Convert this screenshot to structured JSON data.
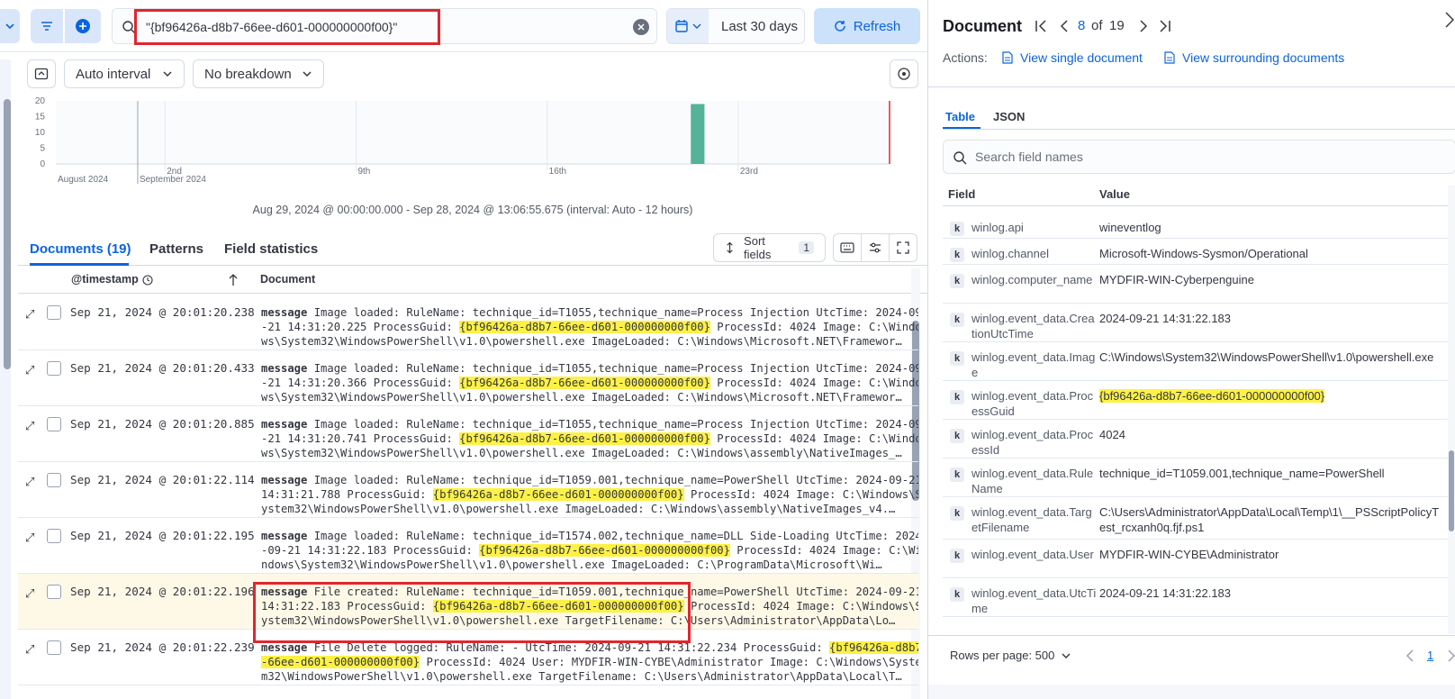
{
  "query": {
    "text": "\"{bf96426a-d8b7-66ee-d601-000000000f00}\""
  },
  "timepicker": {
    "label": "Last 30 days"
  },
  "refresh_label": "Refresh",
  "toolbar": {
    "interval_label": "Auto interval",
    "breakdown_label": "No breakdown"
  },
  "chart_data": {
    "type": "bar",
    "y_ticks": [
      "20",
      "15",
      "10",
      "5",
      "0"
    ],
    "ylim": [
      0,
      20
    ],
    "x_tick_labels": [
      "August 2024",
      "September 2024",
      "2nd",
      "9th",
      "16th",
      "23rd"
    ],
    "bars": [
      {
        "x": "2024-09-21",
        "value": 19
      }
    ],
    "caption": "Aug 29, 2024 @ 00:00:00.000 - Sep 28, 2024 @ 13:06:55.675 (interval: Auto - 12 hours)"
  },
  "tabs": {
    "documents": "Documents (19)",
    "patterns": "Patterns",
    "field_statistics": "Field statistics"
  },
  "sort": {
    "label": "Sort fields",
    "count": "1"
  },
  "table": {
    "col_timestamp": "@timestamp",
    "col_document": "Document",
    "rows": [
      {
        "ts": "Sep 21, 2024 @ 20:01:20.238",
        "key": "message",
        "pre": " Image loaded: RuleName: technique_id=T1055,technique_name=Process Injection UtcTime: 2024-09-21 14:31:20.225 ProcessGuid: ",
        "hl": "{bf96426a-d8b7-66ee-d601-000000000f00}",
        "post": " ProcessId: 4024 Image: C:\\Windows\\System32\\WindowsPowerShell\\v1.0\\powershell.exe ImageLoaded: C:\\Windows\\Microsoft.NET\\Framewor…"
      },
      {
        "ts": "Sep 21, 2024 @ 20:01:20.433",
        "key": "message",
        "pre": " Image loaded: RuleName: technique_id=T1055,technique_name=Process Injection UtcTime: 2024-09-21 14:31:20.366 ProcessGuid: ",
        "hl": "{bf96426a-d8b7-66ee-d601-000000000f00}",
        "post": " ProcessId: 4024 Image: C:\\Windows\\System32\\WindowsPowerShell\\v1.0\\powershell.exe ImageLoaded: C:\\Windows\\Microsoft.NET\\Framewor…"
      },
      {
        "ts": "Sep 21, 2024 @ 20:01:20.885",
        "key": "message",
        "pre": " Image loaded: RuleName: technique_id=T1055,technique_name=Process Injection UtcTime: 2024-09-21 14:31:20.741 ProcessGuid: ",
        "hl": "{bf96426a-d8b7-66ee-d601-000000000f00}",
        "post": " ProcessId: 4024 Image: C:\\Windows\\System32\\WindowsPowerShell\\v1.0\\powershell.exe ImageLoaded: C:\\Windows\\assembly\\NativeImages_…"
      },
      {
        "ts": "Sep 21, 2024 @ 20:01:22.114",
        "key": "message",
        "pre": " Image loaded: RuleName: technique_id=T1059.001,technique_name=PowerShell UtcTime: 2024-09-21 14:31:21.788 ProcessGuid: ",
        "hl": "{bf96426a-d8b7-66ee-d601-000000000f00}",
        "post": " ProcessId: 4024 Image: C:\\Windows\\System32\\WindowsPowerShell\\v1.0\\powershell.exe ImageLoaded: C:\\Windows\\assembly\\NativeImages_v4.…"
      },
      {
        "ts": "Sep 21, 2024 @ 20:01:22.195",
        "key": "message",
        "pre": " Image loaded: RuleName: technique_id=T1574.002,technique_name=DLL Side-Loading UtcTime: 2024-09-21 14:31:22.183 ProcessGuid: ",
        "hl": "{bf96426a-d8b7-66ee-d601-000000000f00}",
        "post": " ProcessId: 4024 Image: C:\\Windows\\System32\\WindowsPowerShell\\v1.0\\powershell.exe ImageLoaded: C:\\ProgramData\\Microsoft\\Wi…"
      },
      {
        "ts": "Sep 21, 2024 @ 20:01:22.196",
        "key": "message",
        "pre": " File created: RuleName: technique_id=T1059.001,technique_name=PowerShell UtcTime: 2024-09-21 14:31:22.183 ProcessGuid: ",
        "hl": "{bf96426a-d8b7-66ee-d601-000000000f00}",
        "post": " ProcessId: 4024 Image: C:\\Windows\\System32\\WindowsPowerShell\\v1.0\\powershell.exe TargetFilename: C:\\Users\\Administrator\\AppData\\Lo…"
      },
      {
        "ts": "Sep 21, 2024 @ 20:01:22.239",
        "key": "message",
        "pre": " File Delete logged: RuleName: - UtcTime: 2024-09-21 14:31:22.234 ProcessGuid: ",
        "hl": "{bf96426a-d8b7-66ee-d601-000000000f00}",
        "post": " ProcessId: 4024 User: MYDFIR-WIN-CYBE\\Administrator Image: C:\\Windows\\System32\\WindowsPowerShell\\v1.0\\powershell.exe TargetFilename: C:\\Users\\Administrator\\AppData\\Local\\T…"
      }
    ]
  },
  "panel": {
    "title": "Document",
    "current": "8",
    "of": "of",
    "total": "19",
    "actions_label": "Actions:",
    "view_single": "View single document",
    "view_surrounding": "View surrounding documents",
    "tab_table": "Table",
    "tab_json": "JSON",
    "search_placeholder": "Search field names",
    "col_field": "Field",
    "col_value": "Value",
    "fields": [
      {
        "name": "winlog.api",
        "value": "wineventlog"
      },
      {
        "name": "winlog.channel",
        "value": "Microsoft-Windows-Sysmon/Operational"
      },
      {
        "name": "winlog.computer_name",
        "value": "MYDFIR-WIN-Cyberpenguine"
      },
      {
        "name": "winlog.event_data.CreationUtcTime",
        "value": "2024-09-21 14:31:22.183"
      },
      {
        "name": "winlog.event_data.Image",
        "value": "C:\\Windows\\System32\\WindowsPowerShell\\v1.0\\powershell.exe"
      },
      {
        "name": "winlog.event_data.ProcessGuid",
        "value": "{bf96426a-d8b7-66ee-d601-000000000f00}"
      },
      {
        "name": "winlog.event_data.ProcessId",
        "value": "4024"
      },
      {
        "name": "winlog.event_data.RuleName",
        "value": "technique_id=T1059.001,technique_name=PowerShell"
      },
      {
        "name": "winlog.event_data.TargetFilename",
        "value": "C:\\Users\\Administrator\\AppData\\Local\\Temp\\1\\__PSScriptPolicyTest_rcxanh0q.fjf.ps1"
      },
      {
        "name": "winlog.event_data.User",
        "value": "MYDFIR-WIN-CYBE\\Administrator"
      },
      {
        "name": "winlog.event_data.UtcTime",
        "value": "2024-09-21 14:31:22.183"
      }
    ],
    "rows_per_page": "Rows per page: 500",
    "page": "1"
  },
  "colors": {
    "accent": "#0b64dd",
    "highlight": "#fdf146",
    "annotation": "#e0262f",
    "bar": "#54b399"
  }
}
